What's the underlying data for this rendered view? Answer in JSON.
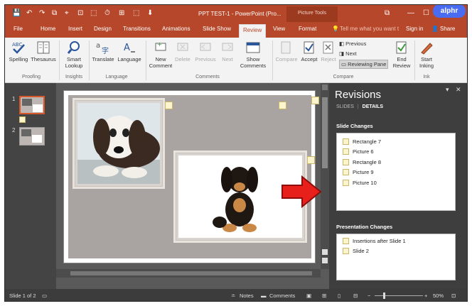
{
  "window": {
    "title": "PPT TEST-1 - PowerPoint (Pro...",
    "contextual_tab": "Picture Tools",
    "badge": "alphr",
    "controls": {
      "restore": "⧉",
      "minimize": "—",
      "maximize": "☐"
    }
  },
  "qat": {
    "save": "💾",
    "undo": "↶",
    "redo": "↷",
    "icons": [
      "⧉",
      "⌖",
      "⊡",
      "⬚",
      "⏱",
      "⊞",
      "⬚",
      "⬇"
    ]
  },
  "tabs": [
    {
      "label": "File"
    },
    {
      "label": "Home"
    },
    {
      "label": "Insert"
    },
    {
      "label": "Design"
    },
    {
      "label": "Transitions"
    },
    {
      "label": "Animations"
    },
    {
      "label": "Slide Show"
    },
    {
      "label": "Review",
      "active": true
    },
    {
      "label": "View"
    },
    {
      "label": "Format"
    }
  ],
  "tell_me": "Tell me what you want t",
  "sign_in": "Sign in",
  "share": "Share",
  "ribbon": {
    "proofing": {
      "group": "Proofing",
      "spelling": "Spelling",
      "thesaurus": "Thesaurus"
    },
    "insights": {
      "group": "Insights",
      "smart_lookup_1": "Smart",
      "smart_lookup_2": "Lookup"
    },
    "language": {
      "group": "Language",
      "translate": "Translate",
      "language": "Language"
    },
    "comments": {
      "group": "Comments",
      "new_comment_1": "New",
      "new_comment_2": "Comment",
      "delete": "Delete",
      "previous": "Previous",
      "next": "Next",
      "show_comments_1": "Show",
      "show_comments_2": "Comments"
    },
    "compare": {
      "group": "Compare",
      "compare": "Compare",
      "accept": "Accept",
      "reject": "Reject",
      "previous": "Previous",
      "next": "Next",
      "reviewing_pane": "Reviewing Pane",
      "end_review_1": "End",
      "end_review_2": "Review"
    },
    "ink": {
      "group": "Ink",
      "start_inking_1": "Start",
      "start_inking_2": "Inking"
    }
  },
  "thumbnails": [
    {
      "num": "1"
    },
    {
      "num": "2"
    }
  ],
  "revisions": {
    "title": "Revisions",
    "tab_slides": "SLIDES",
    "tab_details": "DETAILS",
    "slide_changes_heading": "Slide Changes",
    "slide_changes": [
      "Rectangle 7",
      "Picture 6",
      "Rectangle 8",
      "Picture 9",
      "Picture 10"
    ],
    "presentation_changes_heading": "Presentation Changes",
    "presentation_changes": [
      "Insertions after Slide 1",
      "Slide 2"
    ]
  },
  "status": {
    "slide_of": "Slide 1 of 2",
    "notes": "Notes",
    "comments": "Comments",
    "zoom": "50%"
  },
  "colors": {
    "accent": "#b7472a",
    "arrow": "#e8201c"
  }
}
